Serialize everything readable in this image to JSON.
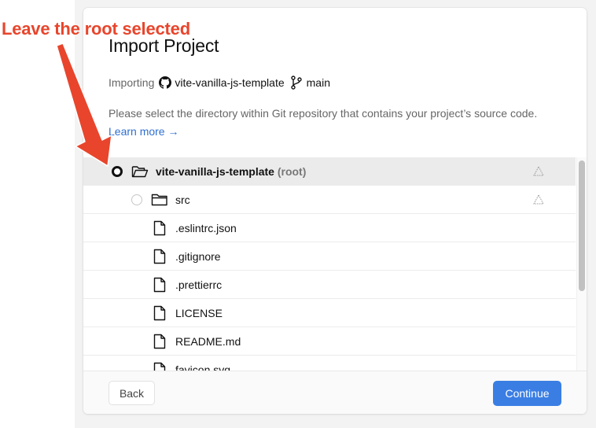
{
  "annotation": {
    "text": "Leave the root selected"
  },
  "modal": {
    "title": "Import Project",
    "importing_label": "Importing",
    "repo": "vite-vanilla-js-template",
    "branch": "main",
    "description": "Please select the directory within Git repository that contains your project’s source code.",
    "learn_more": "Learn more →"
  },
  "tree": {
    "root": {
      "name": "vite-vanilla-js-template",
      "tag": "(root)",
      "selected": true
    },
    "folders": [
      {
        "name": "src"
      }
    ],
    "files": [
      {
        "name": ".eslintrc.json"
      },
      {
        "name": ".gitignore"
      },
      {
        "name": ".prettierrc"
      },
      {
        "name": "LICENSE"
      },
      {
        "name": "README.md"
      },
      {
        "name": "favicon.svg"
      }
    ]
  },
  "footer": {
    "back_label": "Back",
    "continue_label": "Continue"
  },
  "colors": {
    "accent": "#3a7ee4",
    "annotation": "#e8452c",
    "link": "#2f6fd0"
  }
}
